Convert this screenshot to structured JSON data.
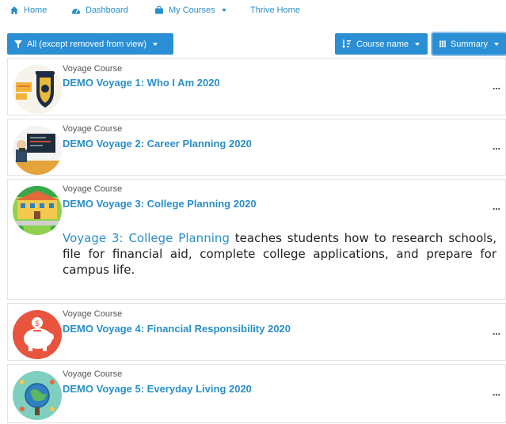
{
  "nav": {
    "home": "Home",
    "dashboard": "Dashboard",
    "my_courses": "My Courses",
    "thrive_home": "Thrive Home"
  },
  "filters": {
    "view_filter": "All (except removed from view)",
    "sort": "Course name",
    "display": "Summary"
  },
  "courses": [
    {
      "category": "Voyage Course",
      "title": "DEMO Voyage 1: Who I Am 2020",
      "menu": "..."
    },
    {
      "category": "Voyage Course",
      "title": "DEMO Voyage 2: Career Planning 2020",
      "menu": "..."
    },
    {
      "category": "Voyage Course",
      "title": "DEMO Voyage 3: College Planning 2020",
      "menu": "...",
      "summary_link": "Voyage 3: College Planning",
      "summary_text": " teaches students how to research schools, file for financial aid, complete college applications, and prepare for campus life."
    },
    {
      "category": "Voyage Course",
      "title": "DEMO Voyage 4: Financial Responsibility 2020",
      "menu": "..."
    },
    {
      "category": "Voyage Course",
      "title": "DEMO Voyage 5: Everyday Living 2020",
      "menu": "..."
    }
  ],
  "colors": {
    "accent": "#2a8fd4",
    "link": "#2a8fc7"
  }
}
